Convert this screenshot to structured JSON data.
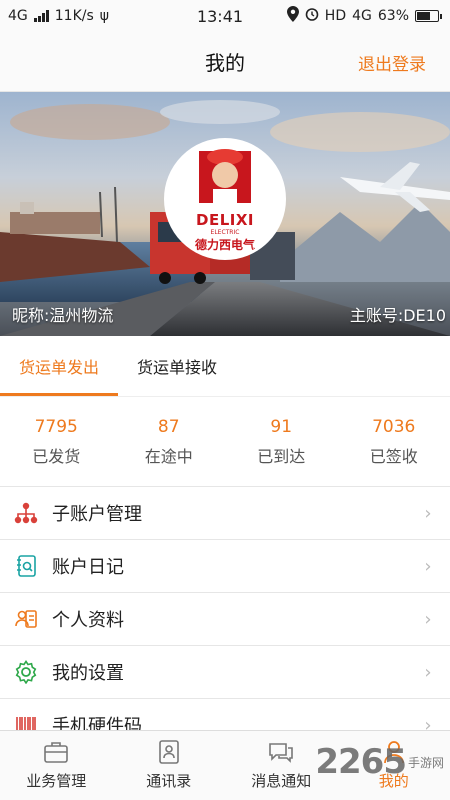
{
  "status_bar": {
    "network_left": "4G",
    "speed": "11K/s",
    "time": "13:41",
    "hd_label": "HD",
    "network_right": "4G",
    "battery": "63%"
  },
  "header": {
    "title": "我的",
    "logout_label": "退出登录"
  },
  "profile": {
    "logo_brand": "DELIXI",
    "logo_sub": "ELECTRIC",
    "logo_cn": "德力西电气",
    "nickname": "昵称:温州物流",
    "main_account": "主账号:DE10"
  },
  "tabs": [
    {
      "label": "货运单发出",
      "active": true
    },
    {
      "label": "货运单接收",
      "active": false
    }
  ],
  "stats": [
    {
      "value": "7795",
      "label": "已发货"
    },
    {
      "value": "87",
      "label": "在途中"
    },
    {
      "value": "91",
      "label": "已到达"
    },
    {
      "value": "7036",
      "label": "已签收"
    }
  ],
  "menu": [
    {
      "label": "子账户管理",
      "icon": "org-chart-icon"
    },
    {
      "label": "账户日记",
      "icon": "account-log-icon"
    },
    {
      "label": "个人资料",
      "icon": "profile-card-icon"
    },
    {
      "label": "我的设置",
      "icon": "gear-icon"
    },
    {
      "label": "手机硬件码",
      "icon": "barcode-icon"
    }
  ],
  "bottom_nav": [
    {
      "label": "业务管理",
      "icon": "briefcase-icon"
    },
    {
      "label": "通讯录",
      "icon": "contacts-icon"
    },
    {
      "label": "消息通知",
      "icon": "chat-icon"
    },
    {
      "label": "我的",
      "icon": "user-icon",
      "active": true
    }
  ],
  "watermark": {
    "big": "2265",
    "small": "手游网"
  },
  "colors": {
    "accent": "#ee7a1e",
    "menu_icon_red": "#d9413a",
    "menu_icon_teal": "#1aa3a3",
    "menu_icon_green": "#2ea84a"
  }
}
